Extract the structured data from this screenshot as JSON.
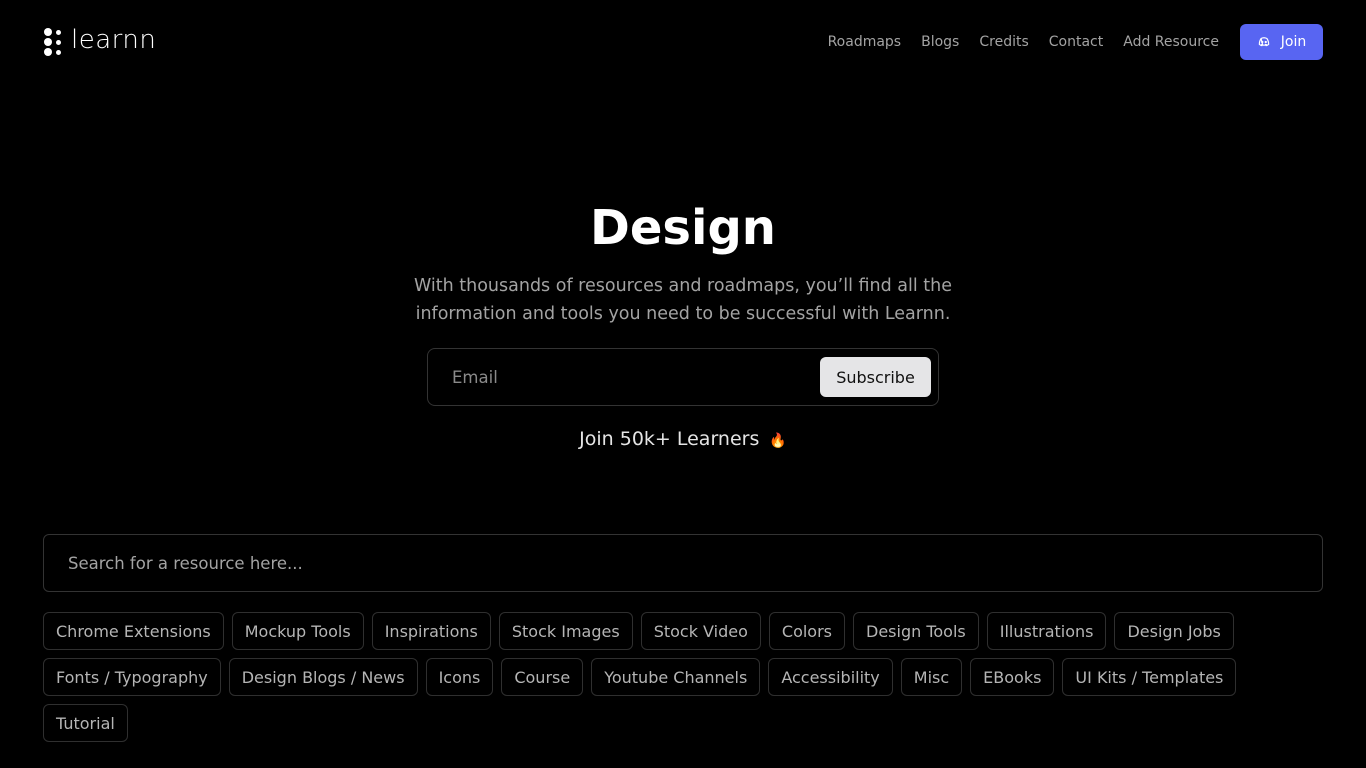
{
  "header": {
    "logo_text": "learnn",
    "nav": [
      "Roadmaps",
      "Blogs",
      "Credits",
      "Contact",
      "Add Resource"
    ],
    "join_label": "Join",
    "join_color": "#5865f2"
  },
  "hero": {
    "title": "Design",
    "subtitle": "With thousands of resources and roadmaps, you’ll find all the information and tools you need to be successful with Learnn."
  },
  "subscribe": {
    "email_placeholder": "Email",
    "button_label": "Subscribe"
  },
  "learners": {
    "text": "Join 50k+ Learners",
    "emoji": "🔥"
  },
  "search": {
    "placeholder": "Search for a resource here..."
  },
  "tags": [
    "Chrome Extensions",
    "Mockup Tools",
    "Inspirations",
    "Stock Images",
    "Stock Video",
    "Colors",
    "Design Tools",
    "Illustrations",
    "Design Jobs",
    "Fonts / Typography",
    "Design Blogs / News",
    "Icons",
    "Course",
    "Youtube Channels",
    "Accessibility",
    "Misc",
    "EBooks",
    "UI Kits / Templates",
    "Tutorial"
  ]
}
